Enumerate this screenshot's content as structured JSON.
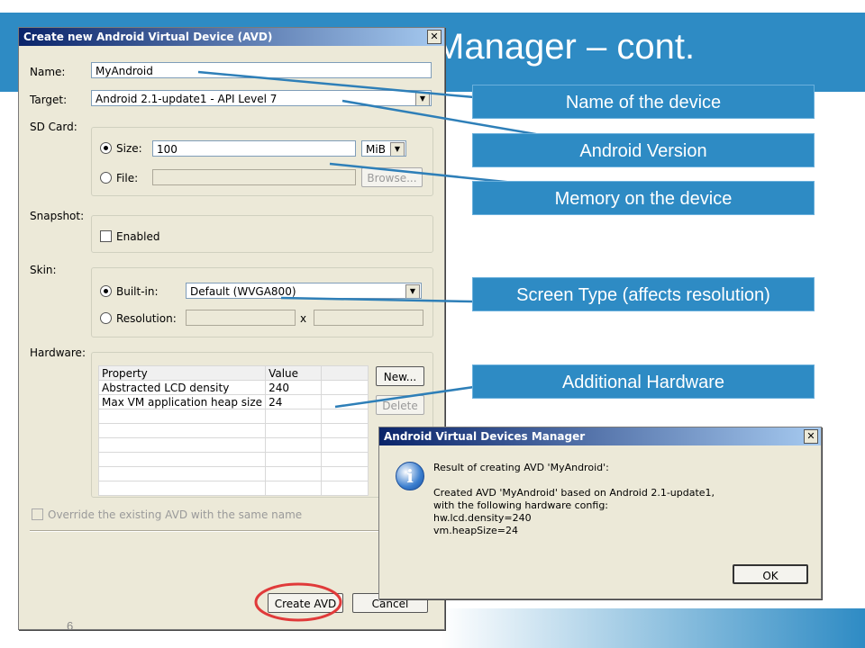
{
  "slide": {
    "title": "Manager – cont.",
    "page_number": "6",
    "accent_color": "#2e8bc4"
  },
  "avd_dialog": {
    "title": "Create new Android Virtual Device (AVD)",
    "close_glyph": "✕",
    "name_label": "Name:",
    "name_value": "MyAndroid",
    "target_label": "Target:",
    "target_value": "Android 2.1-update1 - API Level 7",
    "sdcard_label": "SD Card:",
    "size_label": "Size:",
    "size_value": "100",
    "size_unit": "MiB",
    "file_label": "File:",
    "browse_label": "Browse...",
    "snapshot_label": "Snapshot:",
    "enabled_label": "Enabled",
    "skin_label": "Skin:",
    "builtin_label": "Built-in:",
    "builtin_value": "Default (WVGA800)",
    "resolution_label": "Resolution:",
    "resolution_x": "x",
    "hardware_label": "Hardware:",
    "hw_columns": [
      "Property",
      "Value"
    ],
    "hw_rows": [
      [
        "Abstracted LCD density",
        "240"
      ],
      [
        "Max VM application heap size",
        "24"
      ]
    ],
    "new_button": "New...",
    "delete_button": "Delete",
    "override_label": "Override the existing AVD with the same name",
    "create_button": "Create AVD",
    "cancel_button": "Cancel"
  },
  "result_dialog": {
    "title": "Android Virtual Devices Manager",
    "close_glyph": "✕",
    "icon_glyph": "i",
    "message_line1": "Result of creating AVD 'MyAndroid':",
    "message_body": "Created AVD 'MyAndroid' based on Android 2.1-update1,\nwith the following hardware config:\nhw.lcd.density=240\nvm.heapSize=24",
    "ok_button": "OK"
  },
  "callouts": {
    "name": "Name of the device",
    "version": "Android Version",
    "memory": "Memory on the device",
    "screen": "Screen Type (affects resolution)",
    "hardware": "Additional Hardware"
  }
}
